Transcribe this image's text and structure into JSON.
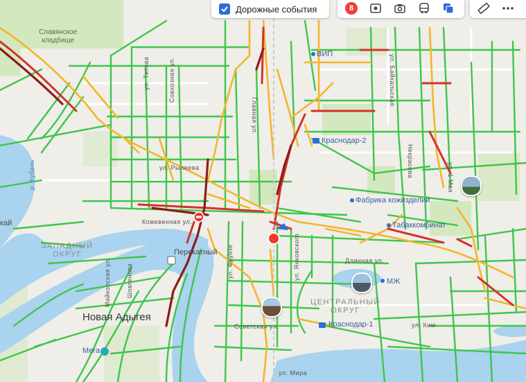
{
  "toolbar": {
    "road_events_label": "Дорожные события",
    "road_events_checked": true,
    "traffic_score": "8",
    "buttons": [
      "traffic-icon",
      "panorama-icon",
      "photo-icon",
      "transit-icon",
      "layers-icon",
      "ruler-icon",
      "more-icon"
    ]
  },
  "labels": {
    "cemetery": "Славянское\nкладбище",
    "cemetery_l1": "Славянское",
    "cemetery_l2": "кладбище",
    "titova": "ул. Титова",
    "sovkhoznaya": "Совхозная ул.",
    "baikalskaya": "ул. Байкальская",
    "vip": "ВИП",
    "krasnodar2": "Краснодар-2",
    "ryleeva": "ул. Рылеева",
    "kuban": "р. Кубань",
    "nekrasova": "Некрасова",
    "may1": "ул. 1 Мая",
    "leather_factory": "Фабрика кожизделий",
    "tobacco_factory": "Табаккомбинат",
    "kozhevennaya": "Кожевенная ул.",
    "western_district_l1": "Западный",
    "western_district_l2": "округ",
    "perekatny": "Перекатный",
    "frunze": "ул. Фрунзе",
    "yankovskogo": "ул. Янковского",
    "dlinnaya": "Длинная ул.",
    "mzh": "МЖ",
    "maikopskaya": "Майкопская ул.",
    "shovgenova": "Шовгенова",
    "central_district_l1": "Центральный",
    "central_district_l2": "округ",
    "novaya_adygea": "Новая Адыгея",
    "krasnodar1": "Краснодар-1",
    "kim": "ул. Ким",
    "sovetskaya": "Советская ул.",
    "mega": "Мега",
    "mira": "ул. Мира",
    "kai": "кай",
    "glavnaya": "Главная ул."
  },
  "colors": {
    "free": "#3fc54a",
    "slow": "#f3b52c",
    "jam": "#d2322b",
    "heavy": "#8c1c18",
    "water": "#a6d2ec",
    "park": "#cfe6b8",
    "accent": "#2b6fd6"
  }
}
